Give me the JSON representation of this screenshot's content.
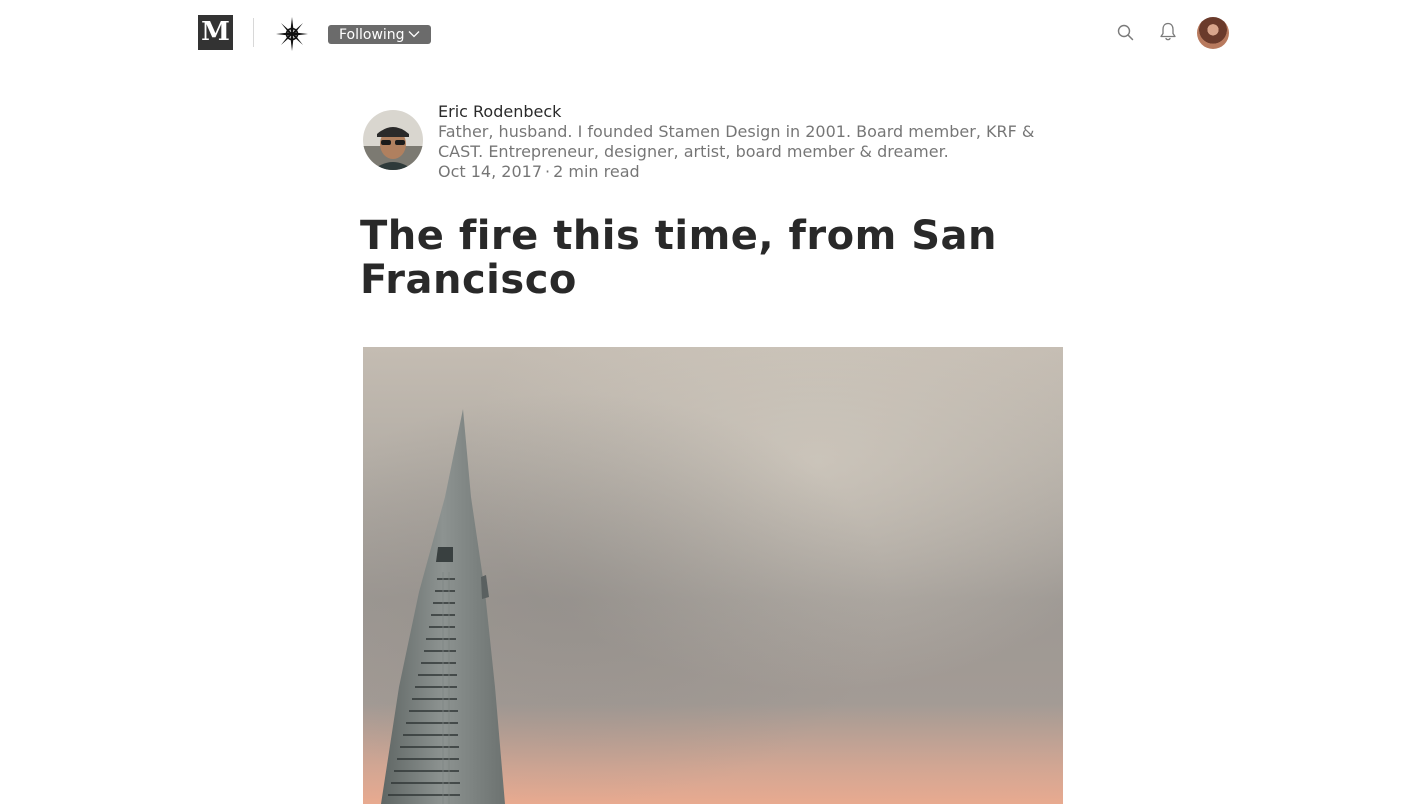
{
  "header": {
    "logo_letter": "M",
    "following_label": "Following",
    "colors": {
      "logo_bg": "#333333",
      "following_bg": "#6b6b6b"
    },
    "icons": [
      "medium-logo-icon",
      "publication-compass-icon",
      "chevron-down-icon",
      "search-icon",
      "bell-icon",
      "user-avatar"
    ]
  },
  "author": {
    "name": "Eric Rodenbeck",
    "bio": "Father, husband. I founded Stamen Design in 2001. Board member, KRF & CAST. Entrepreneur, designer, artist, board member & dreamer.",
    "date": "Oct 14, 2017",
    "separator": "·",
    "read_time": "2 min read"
  },
  "post": {
    "title": "The fire this time, from San Francisco"
  }
}
